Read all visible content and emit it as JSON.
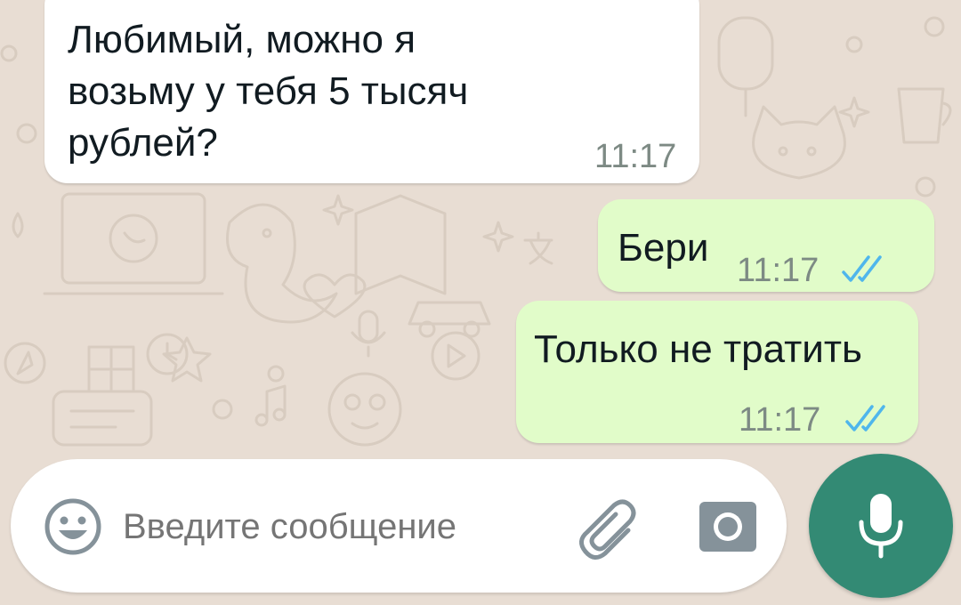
{
  "colors": {
    "wallpaper": "#e8ddd3",
    "incoming_bubble": "#ffffff",
    "outgoing_bubble": "#e1fcc9",
    "read_ticks": "#4fb6ec",
    "mic_button": "#338a74"
  },
  "messages": [
    {
      "direction": "incoming",
      "text": "Любимый, можно я\nвозьму у тебя 5 тысяч\nрублей?",
      "time": "11:17"
    },
    {
      "direction": "outgoing",
      "text": "Бери",
      "time": "11:17",
      "status": "read",
      "status_icon": "double-check-icon"
    },
    {
      "direction": "outgoing",
      "text": "Только не тратить",
      "time": "11:17",
      "status": "read",
      "status_icon": "double-check-icon"
    }
  ],
  "composer": {
    "placeholder": "Введите сообщение",
    "value": "",
    "emoji_icon": "emoji-icon",
    "attach_icon": "paperclip-icon",
    "camera_icon": "camera-icon",
    "mic_icon": "microphone-icon"
  }
}
